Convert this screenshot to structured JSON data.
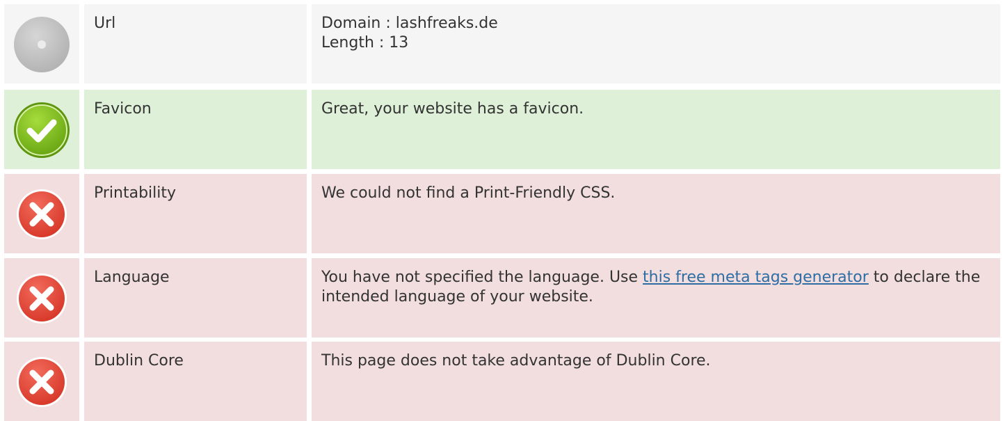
{
  "rows": [
    {
      "status": "neutral",
      "icon": "info-circle-icon",
      "label": "Url",
      "lines": [
        "Domain : lashfreaks.de",
        "Length : 13"
      ]
    },
    {
      "status": "good",
      "icon": "check-circle-icon",
      "label": "Favicon",
      "message": "Great, your website has a favicon."
    },
    {
      "status": "bad",
      "icon": "error-x-icon",
      "label": "Printability",
      "message": "We could not find a Print-Friendly CSS."
    },
    {
      "status": "bad",
      "icon": "error-x-icon",
      "label": "Language",
      "message_before": "You have not specified the language. Use ",
      "link_text": "this free meta tags generator",
      "message_after": " to declare the intended language of your website."
    },
    {
      "status": "bad",
      "icon": "error-x-icon",
      "label": "Dublin Core",
      "message": "This page does not take advantage of Dublin Core."
    }
  ],
  "colors": {
    "neutral_bg": "#f5f5f5",
    "good_bg": "#dff0d8",
    "bad_bg": "#f2dede",
    "link": "#2e6da4",
    "check": "#7fc31c",
    "error": "#e74c3c"
  }
}
